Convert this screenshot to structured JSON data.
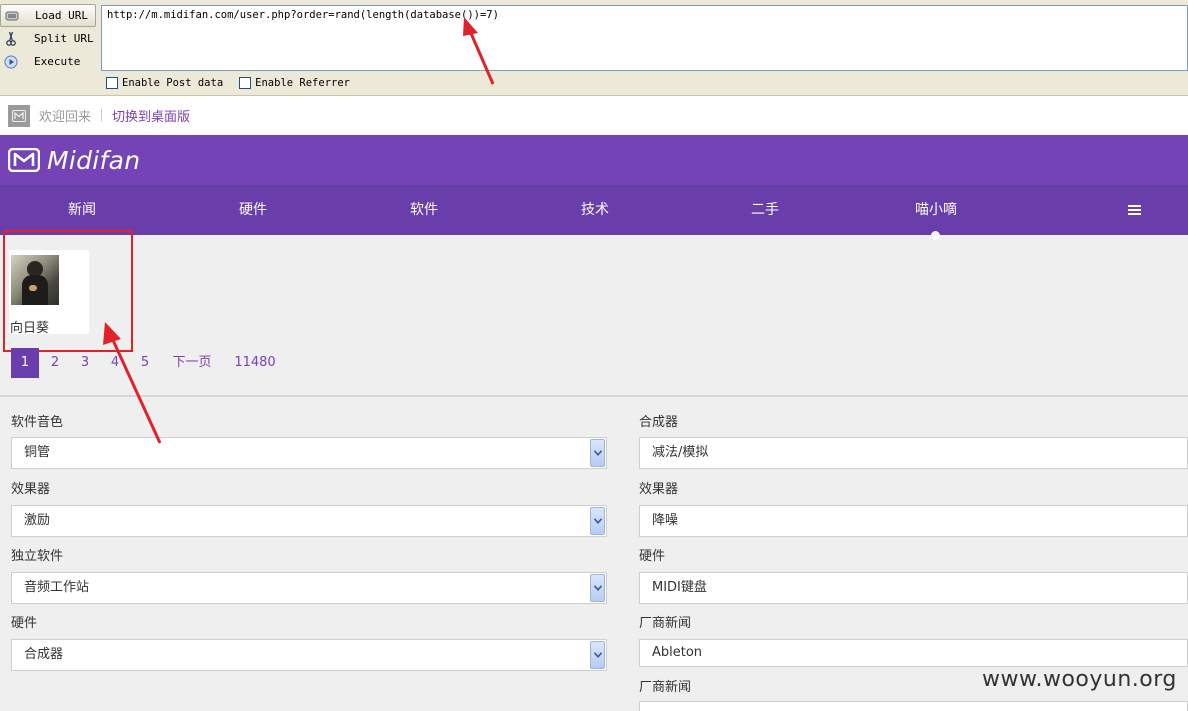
{
  "hackbar": {
    "buttons": [
      {
        "label": "Load URL",
        "icon": "load-url-icon"
      },
      {
        "label": "Split URL",
        "icon": "scissors-icon"
      },
      {
        "label": "Execute",
        "icon": "play-icon"
      }
    ],
    "url": "http://m.midifan.com/user.php?order=rand(length(database())=7)",
    "checkboxes": [
      {
        "label": "Enable Post data",
        "checked": false
      },
      {
        "label": "Enable Referrer",
        "checked": false
      }
    ]
  },
  "welcome": {
    "text": "欢迎回来",
    "switch_link": "切换到桌面版"
  },
  "header": {
    "brand": "Midifan",
    "color": "#7444b7"
  },
  "nav": {
    "items": [
      "新闻",
      "硬件",
      "软件",
      "技术",
      "二手",
      "喵小嘀"
    ],
    "active_index": 5,
    "color": "#6a3eaa"
  },
  "user": {
    "name": "向日葵"
  },
  "pagination": {
    "current": "1",
    "pages": [
      "2",
      "3",
      "4",
      "5"
    ],
    "next": "下一页",
    "last": "11480"
  },
  "filters": {
    "left": [
      {
        "label": "软件音色",
        "value": "铜管"
      },
      {
        "label": "效果器",
        "value": "激励"
      },
      {
        "label": "独立软件",
        "value": "音频工作站"
      },
      {
        "label": "硬件",
        "value": "合成器"
      }
    ],
    "right": [
      {
        "label": "合成器",
        "value": "减法/模拟"
      },
      {
        "label": "效果器",
        "value": "降噪"
      },
      {
        "label": "硬件",
        "value": "MIDI键盘"
      },
      {
        "label": "厂商新闻",
        "value": "Ableton"
      },
      {
        "label": "厂商新闻",
        "value": ""
      }
    ]
  },
  "watermark": "www.wooyun.org",
  "annotation_color": "#e0232b"
}
